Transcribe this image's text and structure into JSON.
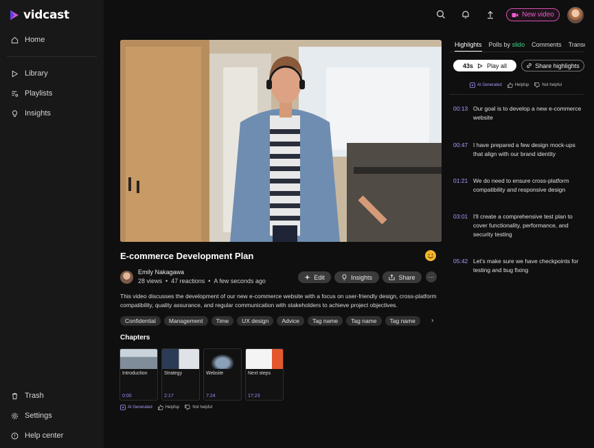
{
  "app": {
    "name": "vidcast"
  },
  "sidebar": {
    "items": [
      {
        "label": "Home",
        "icon": "home-icon"
      },
      {
        "label": "Library",
        "icon": "play-icon"
      },
      {
        "label": "Playlists",
        "icon": "playlist-icon"
      },
      {
        "label": "Insights",
        "icon": "lightbulb-icon"
      }
    ],
    "footer": [
      {
        "label": "Trash",
        "icon": "trash-icon"
      },
      {
        "label": "Settings",
        "icon": "gear-icon"
      },
      {
        "label": "Help center",
        "icon": "help-icon"
      }
    ]
  },
  "topbar": {
    "new_video_label": "New video",
    "accent": "#f05bd0"
  },
  "video": {
    "title": "E-commerce Development Plan",
    "author": "Emily Nakagawa",
    "views": "28 views",
    "reactions": "47 reactions",
    "time": "A few seconds ago",
    "description": "This video discusses the development of our new e-commerce website with a focus on user-friendly design, cross-platform compatibility, quality assurance, and regular communication with stakeholders to achieve project objectives.",
    "actions": {
      "edit": "Edit",
      "insights": "Insights",
      "share": "Share",
      "more": "···"
    }
  },
  "tags": [
    "Confidential",
    "Management",
    "Time",
    "UX design",
    "Advice",
    "Tag name",
    "Tag name",
    "Tag name"
  ],
  "chapters": {
    "title": "Chapters",
    "items": [
      {
        "label": "Introduction",
        "time": "0:00"
      },
      {
        "label": "Strategy",
        "time": "2:17"
      },
      {
        "label": "Website",
        "time": "7:24"
      },
      {
        "label": "Next steps",
        "time": "17:23"
      }
    ]
  },
  "feedback": {
    "ai_label": "AI Generated",
    "helpful": "Helpfup",
    "not_helpful": "Not helpful"
  },
  "right_panel": {
    "tabs": [
      {
        "label": "Highlights"
      },
      {
        "label": "Polls by",
        "suffix": "slido"
      },
      {
        "label": "Comments"
      },
      {
        "label": "Transcript"
      }
    ],
    "play_all": {
      "duration": "43s",
      "label": "Play all"
    },
    "share_highlights": "Share highlights",
    "highlights": [
      {
        "time": "00:13",
        "text": "Our goal is to develop a new e-commerce website"
      },
      {
        "time": "00:47",
        "text": "I have prepared a few design mock-ups that align with our brand identity"
      },
      {
        "time": "01:21",
        "text": "We do need to ensure cross-platform compatibility and responsive design"
      },
      {
        "time": "03:01",
        "text": "I'll create a comprehensive test plan to cover functionality, performance, and security testing"
      },
      {
        "time": "05:42",
        "text": "Let's make sure we have checkpoints for testing and bug fixing"
      }
    ]
  }
}
